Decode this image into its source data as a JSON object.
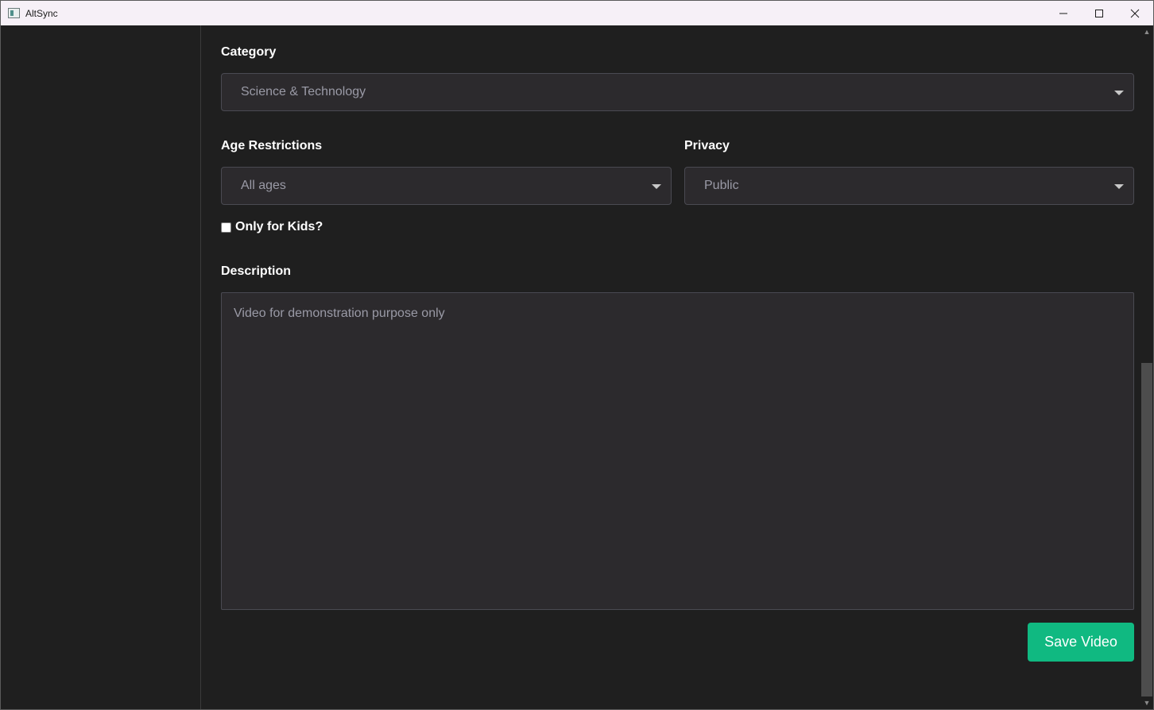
{
  "window": {
    "title": "AltSync",
    "minimize_icon": "minimize-icon",
    "maximize_icon": "maximize-icon",
    "close_icon": "close-icon"
  },
  "form": {
    "category": {
      "label": "Category",
      "value": "Science & Technology"
    },
    "age_restrictions": {
      "label": "Age Restrictions",
      "value": "All ages"
    },
    "privacy": {
      "label": "Privacy",
      "value": "Public"
    },
    "kids_only": {
      "label": "Only for Kids?",
      "checked": false
    },
    "description": {
      "label": "Description",
      "placeholder": "Video for demonstration purpose only"
    },
    "save_label": "Save Video"
  },
  "colors": {
    "accent": "#10b981",
    "background": "#1f1f1f",
    "field": "#2c2a2d"
  }
}
